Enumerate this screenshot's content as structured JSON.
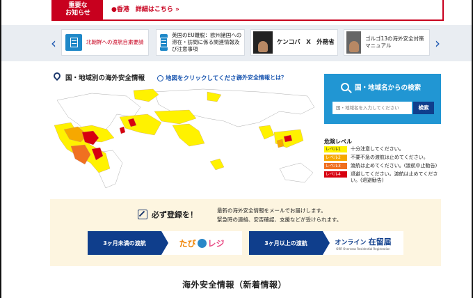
{
  "alert": {
    "label": "重要な\nお知らせ",
    "text": "●香港　詳細はこちら »"
  },
  "carousel": {
    "prev_label": "‹",
    "next_label": "›",
    "cards": [
      {
        "text": "北朝鮮への渡航自粛要請",
        "icon": "document-icon"
      },
      {
        "text": "英国のEU離脱：欧州諸国への滞在・訪問に係る関連情報及び注意事項",
        "icon": "document-icon"
      },
      {
        "text": "ケンコバ　X　外務省",
        "icon": "person-photo"
      },
      {
        "text": "ゴルゴ13の海外安全対策マニュアル",
        "icon": "manga-photo"
      }
    ]
  },
  "map": {
    "title": "国・地域別の海外安全情報",
    "click_link": "地図をクリックしてください",
    "info_link": "海外安全情報とは？"
  },
  "search": {
    "title": "国・地域名からの検索",
    "placeholder": "国・地域名を入力してください",
    "button": "検索"
  },
  "legend": {
    "title": "危険レベル",
    "levels": [
      {
        "label": "レベル1",
        "text": "十分注意してください。",
        "color": "#fff200"
      },
      {
        "label": "レベル2",
        "text": "不要不急の渡航は止めてください。",
        "color": "#f6a800"
      },
      {
        "label": "レベル3",
        "text": "渡航は止めてください。(渡航中止勧告)",
        "color": "#f07020"
      },
      {
        "label": "レベル4",
        "text": "退避してください。渡航は止めてください。(退避勧告)",
        "color": "#d7000f"
      }
    ]
  },
  "register": {
    "title": "必ず登録を！",
    "desc_line1": "最新の海外安全情報をメールでお届けします。",
    "desc_line2": "緊急時の連絡、安否確認、支援などが受けられます。",
    "short_label": "3ヶ月未満の渡航",
    "short_logo_a": "たび",
    "short_logo_b": "レジ",
    "long_label": "3ヶ月以上の渡航",
    "long_logo_a": "オンライン",
    "long_logo_b": "在留届",
    "long_logo_sub": "ORR Overseas Residential Registration"
  },
  "news": {
    "title": "海外安全情報（新着情報）"
  }
}
